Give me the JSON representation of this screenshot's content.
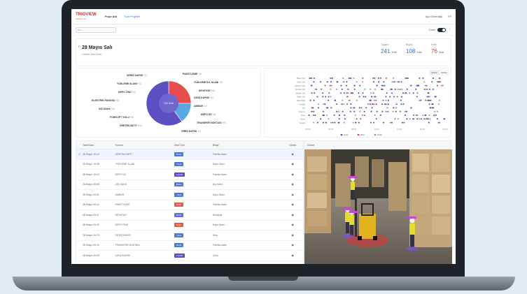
{
  "topbar": {
    "logo": "TRIOVIEW",
    "logo_sub": "SAFETY AI",
    "project": "Proje Adı",
    "project_link": "Tüm Projeler",
    "right_a": "İşçi Güvenliği",
    "right_b": "TR"
  },
  "subbar": {
    "search_placeholder": "Ara...",
    "toggle_label": "Canlı"
  },
  "header": {
    "date": "28 Mayıs Salı",
    "subtitle": "Günlük İhlal Özeti",
    "stats": [
      {
        "label": "Toplam",
        "value": "241",
        "unit": "ihlal",
        "color": "#2a6fd6"
      },
      {
        "label": "Bugün",
        "value": "108",
        "unit": "ihlal",
        "color": "#2a6fd6"
      },
      {
        "label": "Kritik",
        "value": "76",
        "unit": "ihlal",
        "color": "#d93636"
      }
    ]
  },
  "pie_labels": [
    {
      "text": "DENİZ KAPISI",
      "pct": "%2"
    },
    {
      "text": "YÜKLEME ALANI",
      "pct": "%4"
    },
    {
      "text": "DEPO ÖNÜ",
      "pct": "%3"
    },
    {
      "text": "ELEKTRİK PANOSU",
      "pct": "%5"
    },
    {
      "text": "DIŞ SAHA",
      "pct": "%6"
    },
    {
      "text": "FORKLİFT YOLU",
      "pct": "%8"
    },
    {
      "text": "ÜRETİM HATTI",
      "pct": "%12"
    },
    {
      "text": "PAKETLEME",
      "pct": "%4"
    },
    {
      "text": "YÜKLEME İLK ALANI",
      "pct": "%3"
    },
    {
      "text": "SEVKİYAT",
      "pct": "%5"
    },
    {
      "text": "ÇIKIŞ KAPISI",
      "pct": "%2"
    },
    {
      "text": "AMBAR",
      "pct": "%7"
    },
    {
      "text": "DEPO İÇİ",
      "pct": "%6"
    },
    {
      "text": "TRANSFER NOKTASI",
      "pct": "%9"
    },
    {
      "text": "GİRİŞ KAPISI",
      "pct": "%3"
    }
  ],
  "pie_center": "241 İhlal",
  "pie_segments": [
    {
      "value": 25,
      "color": "#e84c4c"
    },
    {
      "value": 15,
      "color": "#5aa7e0"
    },
    {
      "value": 60,
      "color": "#5b4fc2"
    }
  ],
  "dot_chart": {
    "rows": [
      "Baret Yok",
      "Yelek Yok",
      "Eldiven Yok",
      "Gözlük Yok",
      "Maske Yok",
      "Kask Yok",
      "Alan İhlali",
      "Forklift",
      "Hız",
      "Düşme",
      "Kapı",
      "Depo",
      "Yangın"
    ],
    "legend": [
      "Uyarı",
      "İhlal",
      "Kritik"
    ],
    "legend_colors": [
      "#3c49b5",
      "#d93636",
      "#8a8fb5"
    ],
    "ticks": [
      "00:00",
      "04:00",
      "08:00",
      "12:00",
      "16:00",
      "20:00",
      "24:00"
    ],
    "tabs": [
      "Günlük",
      "Haftalık"
    ]
  },
  "table": {
    "headers": [
      "Tarih/Saat",
      "Konum",
      "İhlal Türü",
      "Bölge",
      "Görsel"
    ],
    "rows": [
      {
        "t": "28 Mayıs 10:12",
        "k": "ÜRETİM HATTI",
        "tag": "Baret",
        "tc": "#4b79d4",
        "b": "Fabrika Alanı"
      },
      {
        "t": "28 Mayıs 10:08",
        "k": "YÜKLEME ALANI",
        "tag": "Yelek",
        "tc": "#4b79d4",
        "b": "Depo Alanı"
      },
      {
        "t": "28 Mayıs 10:04",
        "k": "DEPO İÇİ",
        "tag": "Forklift",
        "tc": "#5b4fc2",
        "b": "Fabrika Alanı"
      },
      {
        "t": "28 Mayıs 09:58",
        "k": "DIŞ SAHA",
        "tag": "Baret",
        "tc": "#4b79d4",
        "b": "Dış Saha"
      },
      {
        "t": "28 Mayıs 09:51",
        "k": "AMBAR",
        "tag": "Yelek",
        "tc": "#4b79d4",
        "b": "Depo Alanı"
      },
      {
        "t": "28 Mayıs 09:44",
        "k": "PAKETLEME",
        "tag": "Kritik",
        "tc": "#e35a4a",
        "b": "Fabrika Alanı"
      },
      {
        "t": "28 Mayıs 09:37",
        "k": "SEVKİYAT",
        "tag": "Baret",
        "tc": "#4b79d4",
        "b": "Sevkiyat"
      },
      {
        "t": "28 Mayıs 09:30",
        "k": "DEPO ÖNÜ",
        "tag": "Kritik",
        "tc": "#e35a4a",
        "b": "Depo Alanı"
      },
      {
        "t": "28 Mayıs 09:22",
        "k": "GİRİŞ KAPISI",
        "tag": "Yelek",
        "tc": "#4b79d4",
        "b": "Giriş"
      },
      {
        "t": "28 Mayıs 09:15",
        "k": "TRANSFER NOKTASI",
        "tag": "Baret",
        "tc": "#4b79d4",
        "b": "Fabrika Alanı"
      },
      {
        "t": "28 Mayıs 09:09",
        "k": "ÇIKIŞ KAPISI",
        "tag": "Forklift",
        "tc": "#5b4fc2",
        "b": "Çıkış"
      }
    ]
  },
  "image_panel": {
    "title": "Görsel"
  }
}
